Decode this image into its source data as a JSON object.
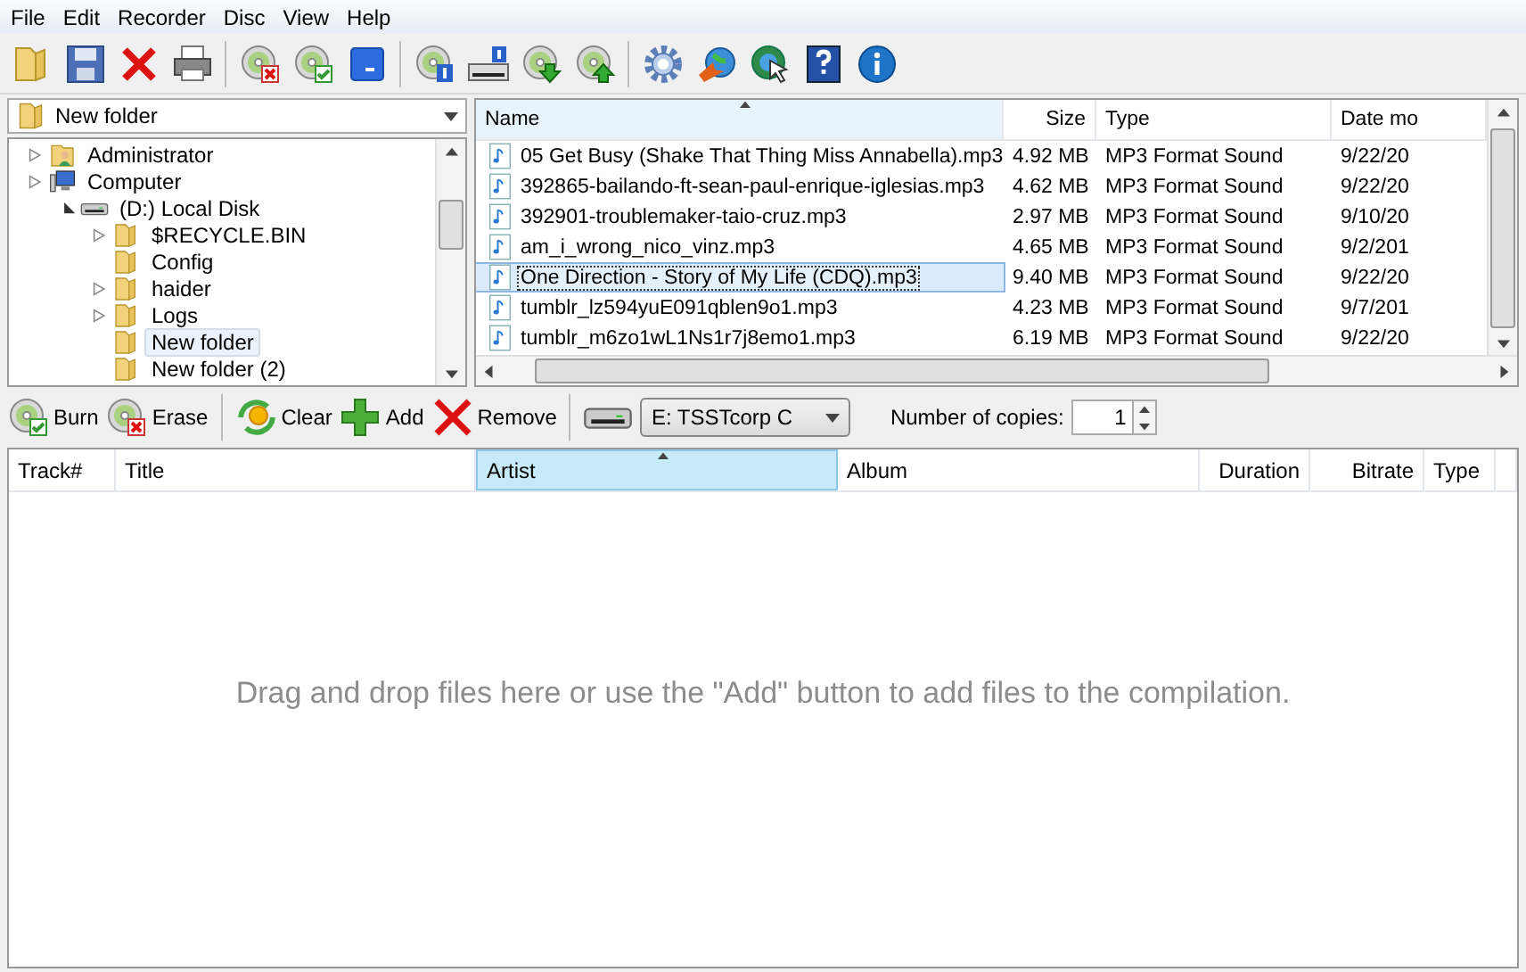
{
  "menu": [
    {
      "label": "File"
    },
    {
      "label": "Edit"
    },
    {
      "label": "Recorder"
    },
    {
      "label": "Disc"
    },
    {
      "label": "View"
    },
    {
      "label": "Help"
    }
  ],
  "folder_combo": {
    "value": "New folder"
  },
  "tree": [
    {
      "label": "Administrator",
      "kind": "user",
      "expanded": false,
      "selected": false
    },
    {
      "label": "Computer",
      "kind": "computer",
      "expanded": false,
      "selected": false,
      "children": [
        {
          "label": "(D:) Local Disk",
          "kind": "drive",
          "expanded": true,
          "selected": false,
          "children": [
            {
              "label": "$RECYCLE.BIN",
              "kind": "folder",
              "expanded": false,
              "selected": false
            },
            {
              "label": "Config",
              "kind": "folder",
              "selected": false
            },
            {
              "label": "haider",
              "kind": "folder",
              "expanded": false,
              "selected": false
            },
            {
              "label": "Logs",
              "kind": "folder",
              "expanded": false,
              "selected": false
            },
            {
              "label": "New folder",
              "kind": "folder",
              "selected": true
            },
            {
              "label": "New folder (2)",
              "kind": "folder",
              "selected": false
            }
          ]
        }
      ]
    }
  ],
  "files": {
    "columns": [
      {
        "label": "Name",
        "sorted": true
      },
      {
        "label": "Size",
        "sorted": false
      },
      {
        "label": "Type",
        "sorted": false
      },
      {
        "label": "Date mo",
        "sorted": false
      }
    ],
    "rows": [
      {
        "name": "05 Get Busy (Shake That Thing Miss Annabella).mp3",
        "size": "4.92 MB",
        "type": "MP3 Format Sound",
        "date": "9/22/20",
        "selected": false
      },
      {
        "name": "392865-bailando-ft-sean-paul-enrique-iglesias.mp3",
        "size": "4.62 MB",
        "type": "MP3 Format Sound",
        "date": "9/22/20",
        "selected": false
      },
      {
        "name": "392901-troublemaker-taio-cruz.mp3",
        "size": "2.97 MB",
        "type": "MP3 Format Sound",
        "date": "9/10/20",
        "selected": false
      },
      {
        "name": "am_i_wrong_nico_vinz.mp3",
        "size": "4.65 MB",
        "type": "MP3 Format Sound",
        "date": "9/2/201",
        "selected": false
      },
      {
        "name": "One Direction - Story of My Life (CDQ).mp3",
        "size": "9.40 MB",
        "type": "MP3 Format Sound",
        "date": "9/22/20",
        "selected": true
      },
      {
        "name": "tumblr_lz594yuE091qblen9o1.mp3",
        "size": "4.23 MB",
        "type": "MP3 Format Sound",
        "date": "9/7/201",
        "selected": false
      },
      {
        "name": "tumblr_m6zo1wL1Ns1r7j8emo1.mp3",
        "size": "6.19 MB",
        "type": "MP3 Format Sound",
        "date": "9/22/20",
        "selected": false
      }
    ]
  },
  "actions": [
    {
      "label": "Burn",
      "kind": "burn"
    },
    {
      "label": "Erase",
      "kind": "erase"
    },
    {
      "label": "Clear",
      "kind": "clear"
    },
    {
      "label": "Add",
      "kind": "add"
    },
    {
      "label": "Remove",
      "kind": "remove"
    }
  ],
  "drive_combo": {
    "value": "E: TSSTcorp C"
  },
  "copies": {
    "label": "Number of copies:",
    "value": "1"
  },
  "compilation": {
    "columns": [
      {
        "label": "Track#",
        "sorted": false
      },
      {
        "label": "Title",
        "sorted": false
      },
      {
        "label": "Artist",
        "sorted": true
      },
      {
        "label": "Album",
        "sorted": false
      },
      {
        "label": "Duration",
        "sorted": false
      },
      {
        "label": "Bitrate",
        "sorted": false
      },
      {
        "label": "Type",
        "sorted": false
      }
    ],
    "empty_message": "Drag and drop files here or use the \"Add\" button to add files to the compilation."
  }
}
